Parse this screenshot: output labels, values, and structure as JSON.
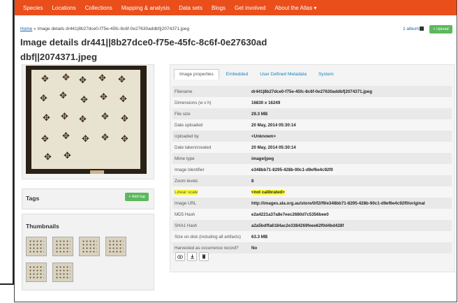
{
  "nav": {
    "items": [
      "Species",
      "Locations",
      "Collections",
      "Mapping & analysis",
      "Data sets",
      "Blogs",
      "Get involved",
      "About the Atlas ▾"
    ],
    "bg_color": "#e94e1b"
  },
  "breadcrumb": {
    "home": "Home",
    "rest": " » Image details dr441|8b27dce0-f75e-45fc-8c6f-0e27630addbf||2074371.jpeg"
  },
  "albums_label": "1 album",
  "upload_label": "+ Upload",
  "page_title": "Image details dr441||8b27dce0-f75e-45fc-8c6f-0e27630addbf||2074371.jpeg",
  "tags": {
    "title": "Tags",
    "add_label": "+ Add tag"
  },
  "thumbnails": {
    "title": "Thumbnails"
  },
  "tabs": [
    "Image properties",
    "Embedded",
    "User Defined Metadata",
    "System"
  ],
  "properties": [
    {
      "key": "Filename",
      "value": "dr441|8b27dce0-f75e-45fc-8c6f-0e27630addbf|2074371.jpeg"
    },
    {
      "key": "Dimensions (w x h)",
      "value": "16830 x 16249"
    },
    {
      "key": "File size",
      "value": "29.3 MB"
    },
    {
      "key": "Date uploaded",
      "value": "20 May, 2014 05:30:14"
    },
    {
      "key": "Uploaded by",
      "value": "<Unknown>"
    },
    {
      "key": "Date taken/created",
      "value": "20 May, 2014 05:30:14"
    },
    {
      "key": "Mime type",
      "value": "image/jpeg"
    },
    {
      "key": "Image Identifier",
      "value": "e348bb71-8295-428b-90c1-d9ef6e4c92f0"
    },
    {
      "key": "Zoom levels",
      "value": "8"
    },
    {
      "key": "Linear scale",
      "value": "<not calibrated>"
    },
    {
      "key": "Image URL",
      "value": "http://images.ala.org.au/store/0/f2/f9/e348bb71-8295-428b-90c1-d9ef6e4c92f0/original"
    },
    {
      "key": "MD5 Hash",
      "value": "e2a4221a37a8e7eec2680d7c5356bee0"
    },
    {
      "key": "SHA1 Hash",
      "value": "a2a5bdffa6184ac2e3384269feee62f0d4bd428f"
    },
    {
      "key": "Size on disk (including all artifacts)",
      "value": "63.3 MB"
    },
    {
      "key": "Harvested as occurrence record?",
      "value": "No"
    }
  ],
  "icons": [
    "eye-icon",
    "download-icon",
    "delete-icon"
  ],
  "colors": {
    "accent": "#e94e1b",
    "button_green": "#5cb85c",
    "highlight": "#ffff33",
    "link": "#1a7fb8"
  }
}
